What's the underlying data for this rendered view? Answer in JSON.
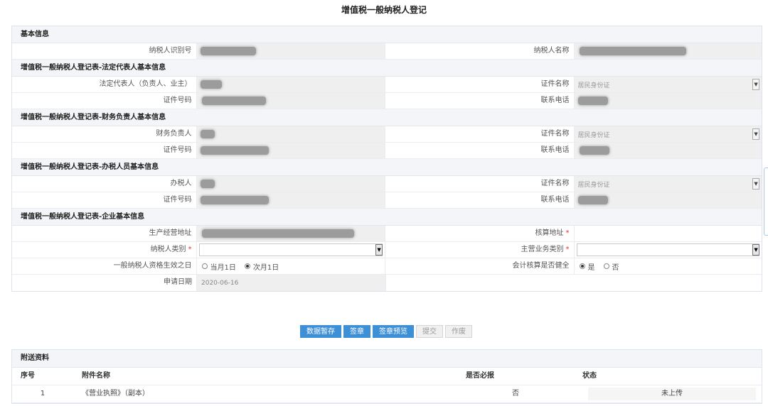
{
  "page": {
    "title": "增值税一般纳税人登记"
  },
  "sections": {
    "basic": "基本信息",
    "legal": "增值税一般纳税人登记表-法定代表人基本信息",
    "finance": "增值税一般纳税人登记表-财务负责人基本信息",
    "handler": "增值税一般纳税人登记表-办税人员基本信息",
    "enterprise": "增值税一般纳税人登记表-企业基本信息"
  },
  "basic": {
    "taxpayer_id_label": "纳税人识别号",
    "taxpayer_name_label": "纳税人名称"
  },
  "legal": {
    "rep_label": "法定代表人（负责人、业主）",
    "cert_name_label": "证件名称",
    "cert_name_value": "居民身份证",
    "cert_no_label": "证件号码",
    "phone_label": "联系电话"
  },
  "finance": {
    "person_label": "财务负责人",
    "cert_name_label": "证件名称",
    "cert_name_value": "居民身份证",
    "cert_no_label": "证件号码",
    "phone_label": "联系电话"
  },
  "handler": {
    "person_label": "办税人",
    "cert_name_label": "证件名称",
    "cert_name_value": "居民身份证",
    "cert_no_label": "证件号码",
    "phone_label": "联系电话"
  },
  "enterprise": {
    "address_label": "生产经营地址",
    "accounting_address_label": "核算地址",
    "taxpayer_type_label": "纳税人类别",
    "main_business_label": "主营业务类别",
    "effective_date_label": "一般纳税人资格生效之日",
    "effective_options": [
      "当月1日",
      "次月1日"
    ],
    "effective_selected": "次月1日",
    "accounting_sound_label": "会计核算是否健全",
    "accounting_options": [
      "是",
      "否"
    ],
    "accounting_selected": "是",
    "apply_date_label": "申请日期",
    "apply_date_value": "2020-06-16",
    "required_mark": "*"
  },
  "buttons": {
    "save": "数据暂存",
    "sign": "签章",
    "sign_preview": "签章预览",
    "submit": "提交",
    "void": "作废"
  },
  "attachments": {
    "title": "附送资料",
    "columns": [
      "序号",
      "附件名称",
      "是否必报",
      "状态"
    ],
    "rows": [
      {
        "index": "1",
        "name": "《营业执照》（副本）",
        "required": "否",
        "status": "未上传"
      }
    ]
  },
  "colors": {
    "primary": "#3d8fd6",
    "required": "#e03030",
    "section_bg": "#f3f5f8"
  }
}
